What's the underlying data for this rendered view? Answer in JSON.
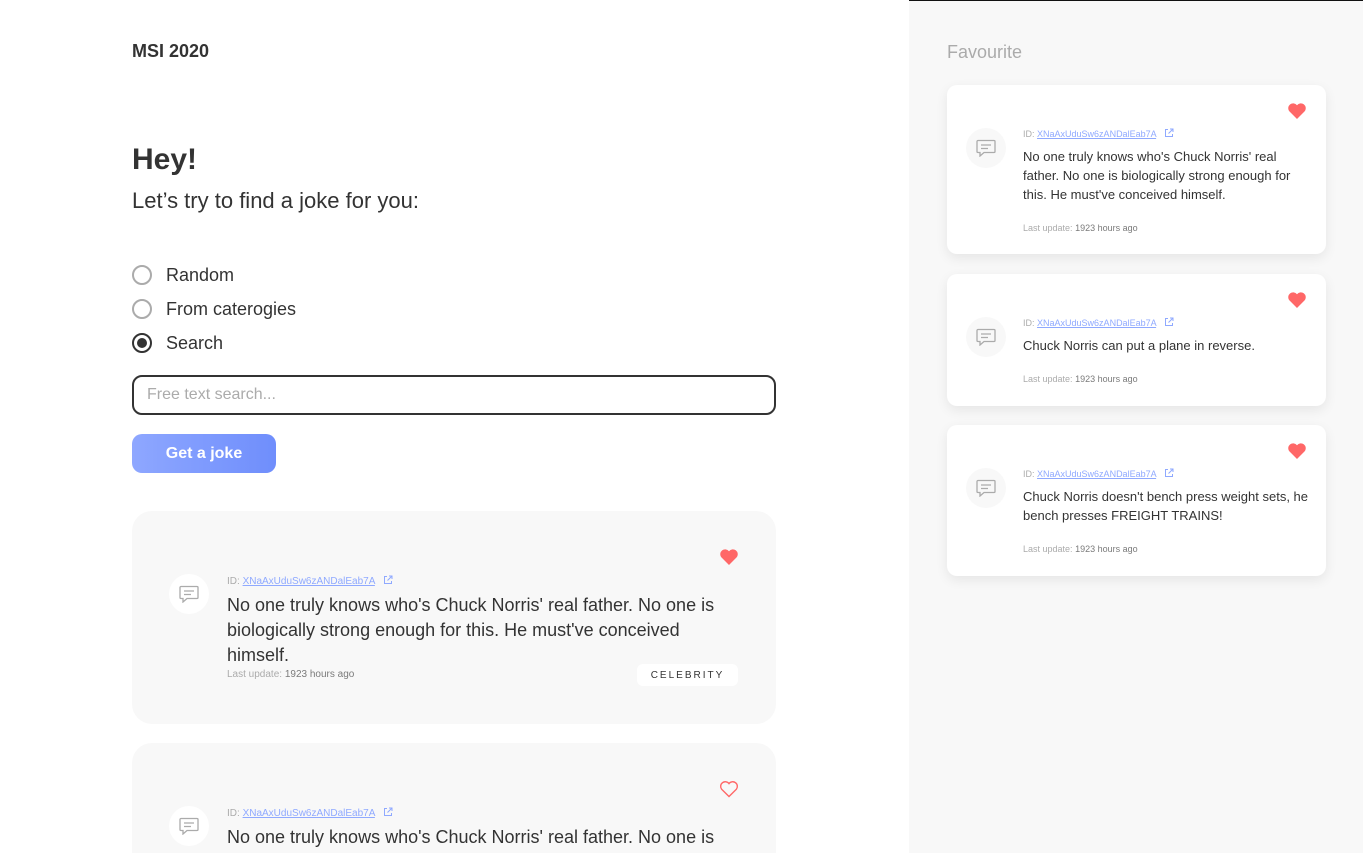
{
  "app": {
    "brand": "MSI 2020"
  },
  "greeting": {
    "title": "Hey!",
    "subtitle": "Let’s try to find a joke for you:"
  },
  "options": [
    {
      "label": "Random",
      "selected": false
    },
    {
      "label": "From caterogies",
      "selected": false
    },
    {
      "label": "Search",
      "selected": true
    }
  ],
  "search": {
    "placeholder": "Free text search...",
    "value": ""
  },
  "actions": {
    "get_joke": "Get a joke"
  },
  "results": [
    {
      "id_label": "ID:",
      "id": "XNaAxUduSw6zANDalEab7A",
      "text": "No one truly knows who's Chuck Norris' real father. No one is biologically strong enough for this. He must've conceived himself.",
      "updated_label": "Last update:",
      "updated": "1923 hours ago",
      "category": "CELEBRITY",
      "favourite": true
    },
    {
      "id_label": "ID:",
      "id": "XNaAxUduSw6zANDalEab7A",
      "text": "No one truly knows who's Chuck Norris' real father. No one is",
      "favourite": false
    }
  ],
  "favourites": {
    "title": "Favourite",
    "items": [
      {
        "id_label": "ID:",
        "id": "XNaAxUduSw6zANDalEab7A",
        "text": "No one truly knows who's Chuck Norris' real father. No one is biologically strong enough for this. He must've conceived himself.",
        "updated_label": "Last update:",
        "updated": "1923 hours ago"
      },
      {
        "id_label": "ID:",
        "id": "XNaAxUduSw6zANDalEab7A",
        "text": "Chuck Norris can put a plane in reverse.",
        "updated_label": "Last update:",
        "updated": "1923 hours ago"
      },
      {
        "id_label": "ID:",
        "id": "XNaAxUduSw6zANDalEab7A",
        "text": "Chuck Norris doesn't bench press weight sets, he bench presses FREIGHT TRAINS!",
        "updated_label": "Last update:",
        "updated": "1923 hours ago"
      }
    ]
  },
  "icons": {
    "comment": "comment-icon",
    "heart": "heart-icon",
    "external": "external-link-icon"
  },
  "colors": {
    "accent": "#8fa9ff",
    "button_start": "#8ea7ff",
    "button_end": "#6f8efc",
    "heart": "#ff6767",
    "text": "#333333",
    "muted": "#ababab",
    "panel": "#f8f8f8"
  }
}
